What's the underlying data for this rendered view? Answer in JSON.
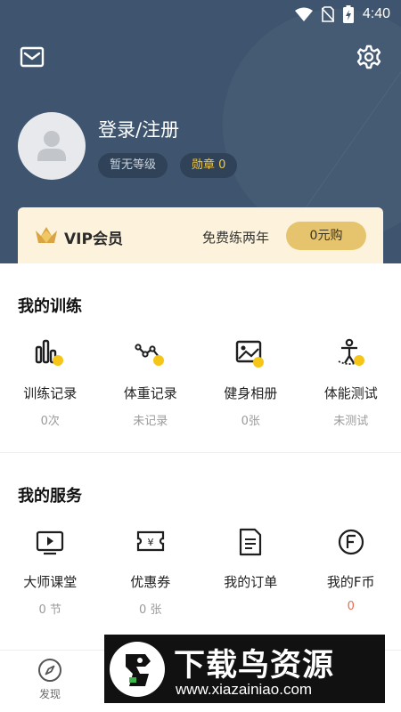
{
  "status_bar": {
    "time": "4:40"
  },
  "profile": {
    "login_label": "登录/注册",
    "level_badge": "暂无等级",
    "medal_badge": "勋章 0"
  },
  "vip": {
    "title": "VIP会员",
    "promo_text": "免费练两年",
    "buy_label": "0元购"
  },
  "training": {
    "title": "我的训练",
    "items": [
      {
        "label": "训练记录",
        "value": "0次",
        "icon": "bar-chart-icon"
      },
      {
        "label": "体重记录",
        "value": "未记录",
        "icon": "trend-line-icon"
      },
      {
        "label": "健身相册",
        "value": "0张",
        "icon": "image-icon"
      },
      {
        "label": "体能测试",
        "value": "未测试",
        "icon": "fitness-test-icon"
      }
    ]
  },
  "services": {
    "title": "我的服务",
    "items": [
      {
        "label": "大师课堂",
        "value": "0 节",
        "icon": "video-class-icon"
      },
      {
        "label": "优惠券",
        "value": "0 张",
        "icon": "coupon-icon"
      },
      {
        "label": "我的订单",
        "value": "",
        "icon": "order-icon"
      },
      {
        "label": "我的F币",
        "value": "0",
        "icon": "f-coin-icon",
        "value_color": "#ef6a4c"
      }
    ]
  },
  "bottom_nav": {
    "discover_label": "发现"
  },
  "watermark": {
    "title": "下载鸟资源",
    "url": "www.xiazainiao.com"
  },
  "colors": {
    "header_bg": "#3f556f",
    "accent_yellow": "#f5c518",
    "vip_bg": "#fdf3dd",
    "vip_button": "#e6c46e"
  }
}
